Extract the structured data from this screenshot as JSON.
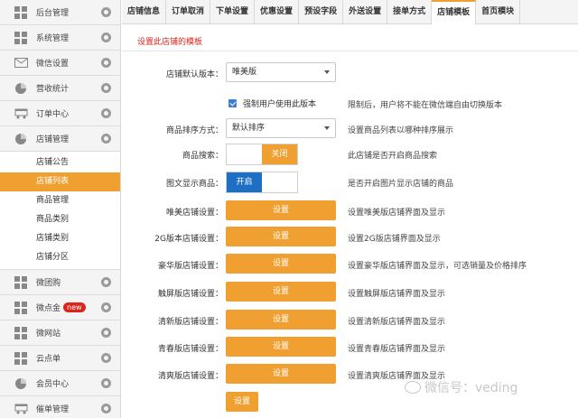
{
  "sidebar": {
    "items": [
      {
        "label": "后台管理",
        "icon": "grid-icon"
      },
      {
        "label": "系统管理",
        "icon": "grid-icon"
      },
      {
        "label": "微信设置",
        "icon": "envelope-icon"
      },
      {
        "label": "营收统计",
        "icon": "pie-chart-icon"
      },
      {
        "label": "订单中心",
        "icon": "cart-icon"
      },
      {
        "label": "店铺管理",
        "icon": "pie-chart-icon"
      }
    ],
    "submenu": [
      {
        "label": "店铺公告"
      },
      {
        "label": "店铺列表",
        "active": true
      },
      {
        "label": "商品管理"
      },
      {
        "label": "商品类别"
      },
      {
        "label": "店铺类别"
      },
      {
        "label": "店铺分区"
      }
    ],
    "items_after": [
      {
        "label": "微团购",
        "icon": "grid-icon"
      },
      {
        "label": "微点金",
        "icon": "grid-icon",
        "badge": "new"
      },
      {
        "label": "微网站",
        "icon": "grid-icon"
      },
      {
        "label": "云点单",
        "icon": "grid-icon"
      },
      {
        "label": "会员中心",
        "icon": "pie-chart-icon"
      },
      {
        "label": "催单管理",
        "icon": "cart-icon"
      }
    ]
  },
  "tabs": [
    {
      "label": "店铺信息"
    },
    {
      "label": "订单取消"
    },
    {
      "label": "下单设置"
    },
    {
      "label": "优惠设置"
    },
    {
      "label": "预设字段"
    },
    {
      "label": "外送设置"
    },
    {
      "label": "接单方式"
    },
    {
      "label": "店铺模板",
      "active": true
    },
    {
      "label": "首页模块"
    }
  ],
  "main": {
    "hint": "设置此店铺的模板",
    "default_version": {
      "label": "店铺默认版本：",
      "value": "唯美版"
    },
    "force_version": {
      "label": "强制用户使用此版本",
      "desc": "限制后，用户将不能在微信端自由切换版本",
      "checked": true
    },
    "sort_mode": {
      "label": "商品排序方式：",
      "value": "默认排序",
      "desc": "设置商品列表以哪种排序展示"
    },
    "search": {
      "label": "商品搜索：",
      "state_text": "关闭",
      "desc": "此店铺是否开启商品搜索"
    },
    "image_display": {
      "label": "图文显示商品：",
      "state_text": "开启",
      "desc": "是否开启图片显示店铺的商品"
    },
    "settings": [
      {
        "label": "唯美店铺设置：",
        "button": "设置",
        "desc": "设置唯美版店铺界面及显示"
      },
      {
        "label": "2G版本店铺设置：",
        "button": "设置",
        "desc": "设置2G版店铺界面及显示"
      },
      {
        "label": "豪华版店铺设置：",
        "button": "设置",
        "desc": "设置豪华版店铺界面及显示，可选销量及价格排序"
      },
      {
        "label": "触屏版店铺设置：",
        "button": "设置",
        "desc": "设置触屏版店铺界面及显示"
      },
      {
        "label": "清新版店铺设置：",
        "button": "设置",
        "desc": "设置清新版店铺界面及显示"
      },
      {
        "label": "青春版店铺设置：",
        "button": "设置",
        "desc": "设置青春版店铺界面及显示"
      },
      {
        "label": "清爽版店铺设置：",
        "button": "设置",
        "desc": "设置清爽版店铺界面及显示"
      }
    ],
    "save_label": "设置"
  },
  "watermark": "微信号：veding",
  "colors": {
    "accent": "#f0a030",
    "toggle_on": "#1d6fc5",
    "hint": "#d9261c"
  }
}
